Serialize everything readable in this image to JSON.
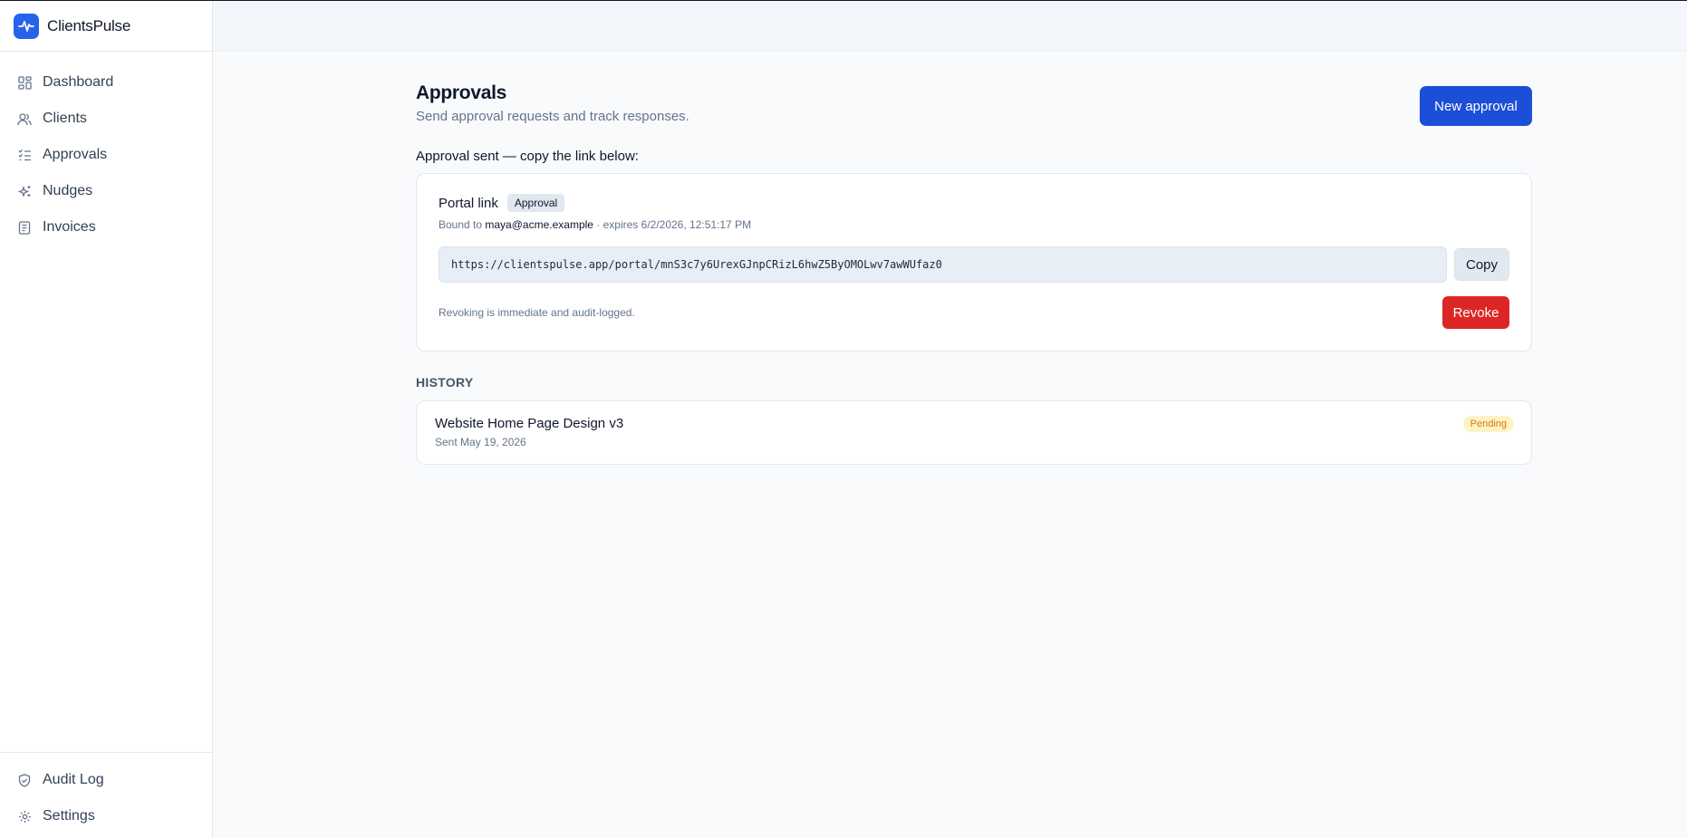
{
  "brand": {
    "name": "ClientsPulse",
    "accent": "#2563eb"
  },
  "nav": {
    "items": [
      {
        "label": "Dashboard",
        "icon": "dashboard-icon"
      },
      {
        "label": "Clients",
        "icon": "users-icon"
      },
      {
        "label": "Approvals",
        "icon": "checklist-icon"
      },
      {
        "label": "Nudges",
        "icon": "sparkles-icon"
      },
      {
        "label": "Invoices",
        "icon": "receipt-icon"
      }
    ],
    "bottom": [
      {
        "label": "Audit Log",
        "icon": "shield-icon"
      },
      {
        "label": "Settings",
        "icon": "gear-icon"
      }
    ]
  },
  "page": {
    "title": "Approvals",
    "subtitle": "Send approval requests and track responses.",
    "new_button": "New approval"
  },
  "notice": "Approval sent — copy the link below:",
  "portal": {
    "title": "Portal link",
    "badge": "Approval",
    "bound_prefix": "Bound to",
    "bound_email": "maya@acme.example",
    "expires": "· expires 6/2/2026, 12:51:17 PM",
    "url": "https://clientspulse.app/portal/mnS3c7y6UrexGJnpCRizL6hwZ5ByOMOLwv7awWUfaz0",
    "copy_label": "Copy",
    "note": "Revoking is immediate and audit-logged.",
    "revoke_label": "Revoke",
    "danger_color": "#dc2626"
  },
  "history": {
    "label": "HISTORY",
    "items": [
      {
        "title": "Website Home Page Design v3",
        "sent": "Sent May 19, 2026",
        "status": "Pending"
      }
    ]
  }
}
